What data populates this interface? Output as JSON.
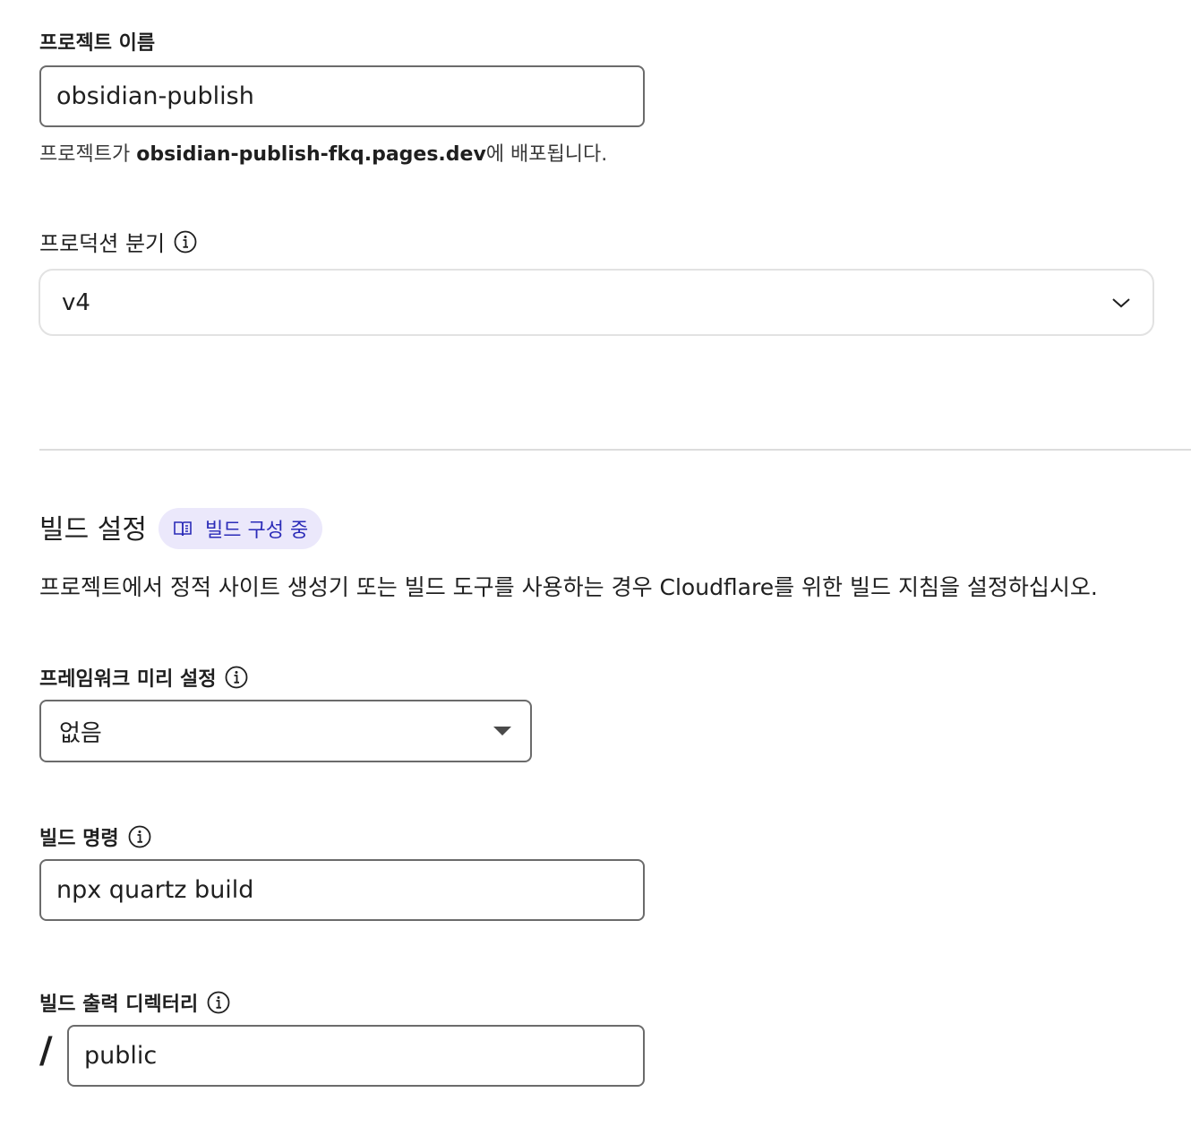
{
  "project": {
    "label": "프로젝트 이름",
    "value": "obsidian-publish",
    "help_prefix": "프로젝트가 ",
    "help_domain": "obsidian-publish-fkq.pages.dev",
    "help_suffix": "에 배포됩니다."
  },
  "production_branch": {
    "label": "프로덕션 분기",
    "value": "v4"
  },
  "build_settings": {
    "title": "빌드 설정",
    "badge": "빌드 구성 중",
    "description": "프로젝트에서 정적 사이트 생성기 또는 빌드 도구를 사용하는 경우 Cloudflare를 위한 빌드 지침을 설정하십시오."
  },
  "framework_preset": {
    "label": "프레임워크 미리 설정",
    "value": "없음"
  },
  "build_command": {
    "label": "빌드 명령",
    "value": "npx quartz build"
  },
  "build_output": {
    "label": "빌드 출력 디렉터리",
    "prefix": "/",
    "value": "public"
  },
  "icons": {
    "info": "info-icon",
    "chevron": "chevron-down-icon",
    "caret": "caret-down-icon",
    "book": "book-icon"
  }
}
